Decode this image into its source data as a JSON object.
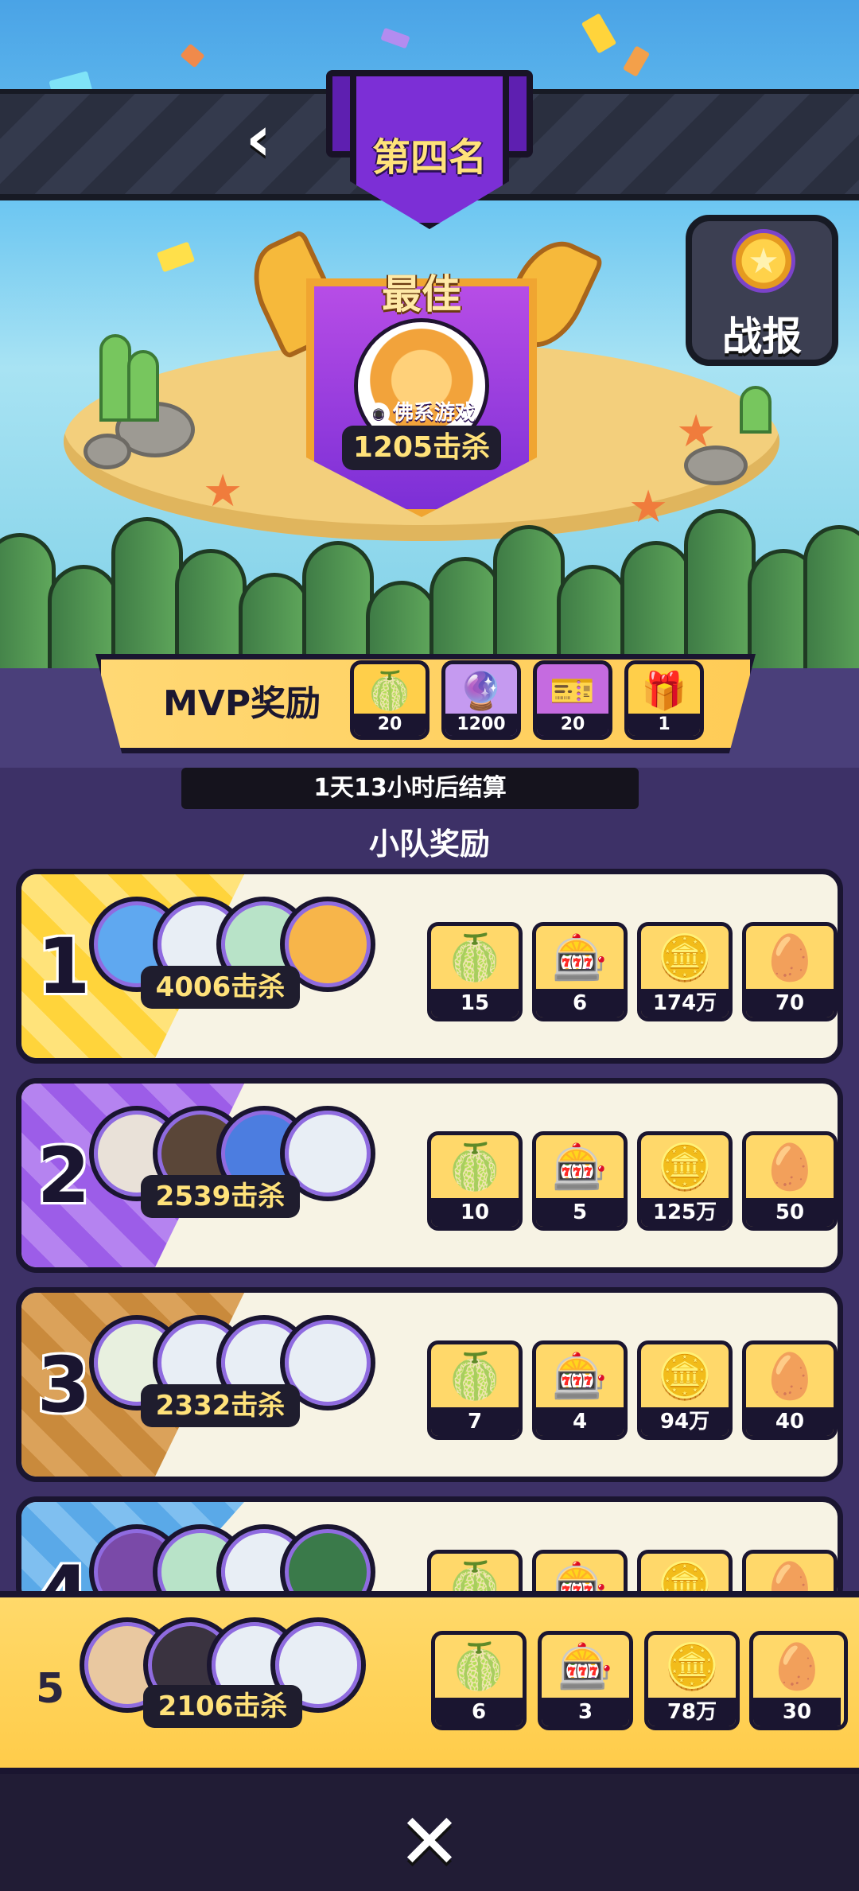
{
  "header": {
    "rank_label": "第四名",
    "back_glyph": "‹",
    "report_label": "战报"
  },
  "mvp": {
    "title": "最佳",
    "player": "佛系游戏",
    "kills": "1205击杀",
    "reward_label": "MVP奖励",
    "rewards": [
      {
        "icon": "durian-fruit-icon",
        "qty": "20"
      },
      {
        "icon": "gem-orbs-icon",
        "qty": "1200"
      },
      {
        "icon": "ticket-icon",
        "qty": "20"
      },
      {
        "icon": "gift-box-icon",
        "qty": "1"
      }
    ]
  },
  "settle_text": "1天13小时后结算",
  "team_title": "小队奖励",
  "ranks": [
    {
      "num": "1",
      "kills": "4006击杀",
      "rewards": [
        "15",
        "6",
        "174万",
        "70"
      ]
    },
    {
      "num": "2",
      "kills": "2539击杀",
      "rewards": [
        "10",
        "5",
        "125万",
        "50"
      ]
    },
    {
      "num": "3",
      "kills": "2332击杀",
      "rewards": [
        "7",
        "4",
        "94万",
        "40"
      ]
    },
    {
      "num": "4",
      "kills": "",
      "rewards": [
        "",
        "",
        "",
        ""
      ]
    }
  ],
  "my_rank": {
    "num": "5",
    "kills": "2106击杀",
    "rewards": [
      "6",
      "3",
      "78万",
      "30"
    ]
  },
  "reward_icons": [
    "durian-fruit-icon",
    "mystery-box-icon",
    "gold-coins-icon",
    "capsule-egg-icon"
  ],
  "close_glyph": "✕",
  "colors": {
    "rank1": "#ffd43b",
    "rank2": "#9c5de8",
    "rank3": "#c98a3c",
    "rank4": "#5aa9e8",
    "accent_gold": "#ffe27a",
    "purple": "#7c2fd6"
  }
}
